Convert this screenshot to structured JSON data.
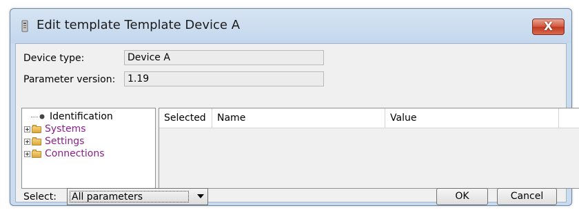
{
  "window": {
    "title": "Edit template Template Device A",
    "close_label": "X"
  },
  "device_type": {
    "label": "Device type:",
    "value": "Device A"
  },
  "parameter_version": {
    "label": "Parameter version:",
    "value": "1.19"
  },
  "tree": {
    "items": [
      {
        "label": "Identification",
        "kind": "leaf"
      },
      {
        "label": "Systems",
        "kind": "folder"
      },
      {
        "label": "Settings",
        "kind": "folder"
      },
      {
        "label": "Connections",
        "kind": "folder"
      }
    ]
  },
  "table": {
    "columns": [
      "Selected",
      "Name",
      "Value"
    ]
  },
  "select": {
    "label": "Select:",
    "value": "All parameters"
  },
  "buttons": {
    "ok": "OK",
    "cancel": "Cancel"
  },
  "colors": {
    "titlebar": "#c9dbee",
    "close": "#c1391f",
    "link": "#8b1f8b"
  }
}
